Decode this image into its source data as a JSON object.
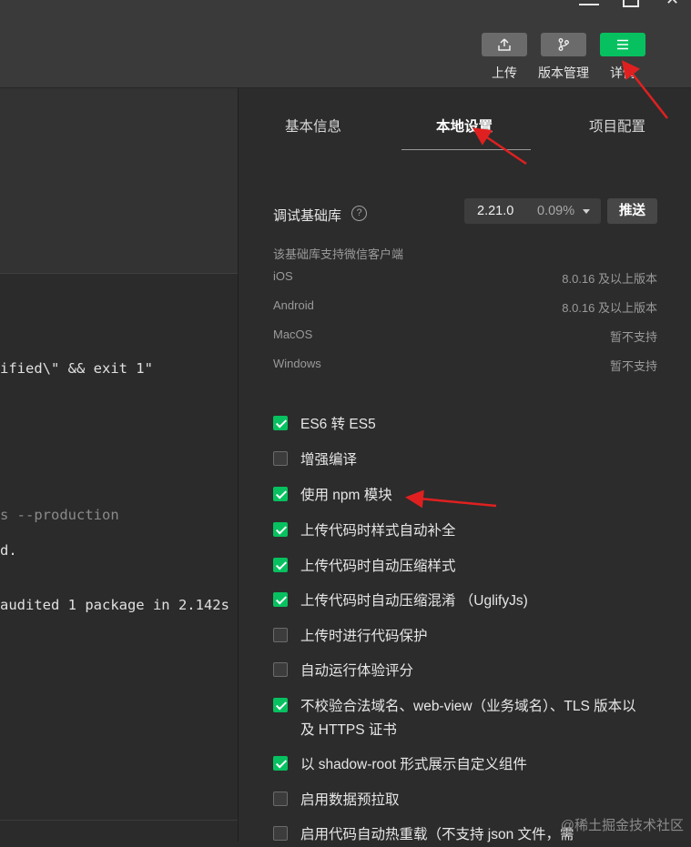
{
  "toolbar": {
    "upload_label": "上传",
    "version_label": "版本管理",
    "detail_label": "详情"
  },
  "editor": {
    "lines": [
      {
        "text": "ified\\\" && exit 1\"",
        "dim": false
      },
      {
        "text": "s --production",
        "dim": true
      },
      {
        "text": "d.",
        "dim": false
      },
      {
        "text": "audited 1 package in 2.142s",
        "dim": false
      }
    ]
  },
  "tabs": [
    {
      "label": "基本信息",
      "active": false
    },
    {
      "label": "本地设置",
      "active": true
    },
    {
      "label": "项目配置",
      "active": false
    }
  ],
  "debug_lib": {
    "label": "调试基础库",
    "help": "?",
    "version": "2.21.0",
    "percent": "0.09%",
    "push_label": "推送",
    "support_title": "该基础库支持微信客户端",
    "clients": [
      {
        "os": "iOS",
        "value": "8.0.16 及以上版本"
      },
      {
        "os": "Android",
        "value": "8.0.16 及以上版本"
      },
      {
        "os": "MacOS",
        "value": "暂不支持"
      },
      {
        "os": "Windows",
        "value": "暂不支持"
      }
    ]
  },
  "options": [
    {
      "label": "ES6 转 ES5",
      "checked": true
    },
    {
      "label": "增强编译",
      "checked": false
    },
    {
      "label": "使用 npm 模块",
      "checked": true
    },
    {
      "label": "上传代码时样式自动补全",
      "checked": true
    },
    {
      "label": "上传代码时自动压缩样式",
      "checked": true
    },
    {
      "label": "上传代码时自动压缩混淆 （UglifyJs)",
      "checked": true
    },
    {
      "label": "上传时进行代码保护",
      "checked": false
    },
    {
      "label": "自动运行体验评分",
      "checked": false
    },
    {
      "label": "不校验合法域名、web-view（业务域名）、TLS 版本以及 HTTPS 证书",
      "checked": true
    },
    {
      "label": "以 shadow-root 形式展示自定义组件",
      "checked": true
    },
    {
      "label": "启用数据预拉取",
      "checked": false
    },
    {
      "label": "启用代码自动热重载（不支持 json 文件，需",
      "checked": false
    }
  ],
  "watermark": "@稀土掘金技术社区",
  "colors": {
    "accent_green": "#07c160",
    "arrow_red": "#e02020"
  },
  "icons": {
    "upload": "upload-icon",
    "version": "git-branch-icon",
    "detail": "menu-icon"
  }
}
